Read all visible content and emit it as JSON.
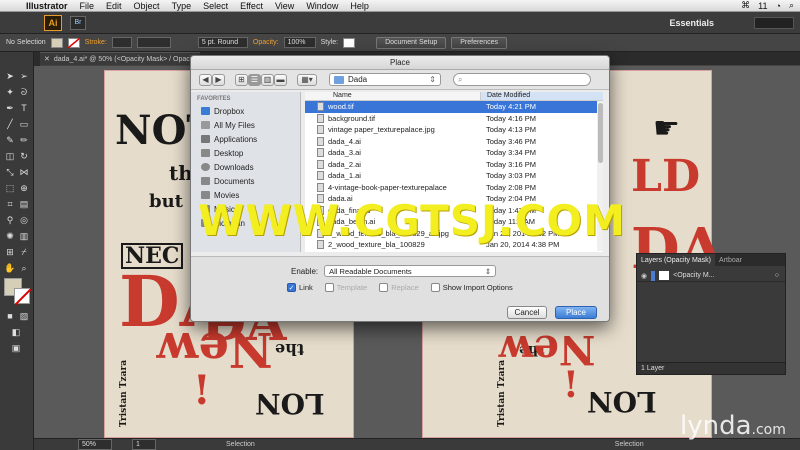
{
  "menubar": {
    "app": "Illustrator",
    "items": [
      "File",
      "Edit",
      "Object",
      "Type",
      "Select",
      "Effect",
      "View",
      "Window",
      "Help"
    ],
    "status_number": "11"
  },
  "appbar": {
    "logo": "Ai",
    "bridge": "Br",
    "workspace": "Essentials"
  },
  "controlbar": {
    "selection": "No Selection",
    "stroke_label": "Stroke:",
    "brush": "5 pt. Round",
    "opacity_label": "Opacity:",
    "opacity_value": "100%",
    "style_label": "Style:",
    "doc_setup": "Document Setup",
    "preferences": "Preferences"
  },
  "document": {
    "tab_title": "dada_4.ai* @ 50% (<Opacity Mask> / Opacity"
  },
  "poster_left": {
    "words": [
      "NOT",
      "the",
      "but",
      "NEC",
      "DA",
      "DA",
      "New",
      "the",
      "!",
      "LON",
      "Tristan Tzara"
    ]
  },
  "poster_right": {
    "words": [
      "LD",
      "DA",
      "the",
      "New",
      "!",
      "LON",
      "Tristan Tzara"
    ]
  },
  "dialog": {
    "title": "Place",
    "location": "Dada",
    "sidebar_header": "FAVORITES",
    "sidebar_items": [
      "Dropbox",
      "All My Files",
      "Applications",
      "Desktop",
      "Downloads",
      "Documents",
      "Movies",
      "Music",
      "Victorian"
    ],
    "col_name": "Name",
    "col_date": "Date Modified",
    "files": [
      {
        "name": "wood.tif",
        "date": "Today 4:21 PM"
      },
      {
        "name": "background.tif",
        "date": "Today 4:16 PM"
      },
      {
        "name": "vintage paper_texturepalace.jpg",
        "date": "Today 4:13 PM"
      },
      {
        "name": "dada_4.ai",
        "date": "Today 3:46 PM"
      },
      {
        "name": "dada_3.ai",
        "date": "Today 3:34 PM"
      },
      {
        "name": "dada_2.ai",
        "date": "Today 3:16 PM"
      },
      {
        "name": "dada_1.ai",
        "date": "Today 3:03 PM"
      },
      {
        "name": "4-vintage-book-paper-texturepalace",
        "date": "Today 2:08 PM"
      },
      {
        "name": "dada.ai",
        "date": "Today 2:04 PM"
      },
      {
        "name": "dada_final.ai",
        "date": "Today 1:47 PM"
      },
      {
        "name": "dada_begin.ai",
        "date": "Today 11:3 AM"
      },
      {
        "name": "2_wood_texture_bla_100829_as.jpg",
        "date": "Jan 20, 2014 4:32 PM"
      },
      {
        "name": "2_wood_texture_bla_100829",
        "date": "Jan 20, 2014 4:38 PM"
      }
    ],
    "enable_label": "Enable:",
    "enable_value": "All Readable Documents",
    "options": {
      "link": "Link",
      "template": "Template",
      "replace": "Replace",
      "import": "Show Import Options"
    },
    "cancel": "Cancel",
    "place": "Place"
  },
  "layers": {
    "tab1": "Layers (Opacity Mask)",
    "tab2": "Artboar",
    "layer_name": "<Opacity M...",
    "footer": "1 Layer"
  },
  "status": {
    "zoom": "50%",
    "page": "1",
    "mode": "Selection"
  },
  "watermark": "WWW.CGTSJ.COM",
  "lynda": "lynda",
  "lynda_suffix": ".com"
}
